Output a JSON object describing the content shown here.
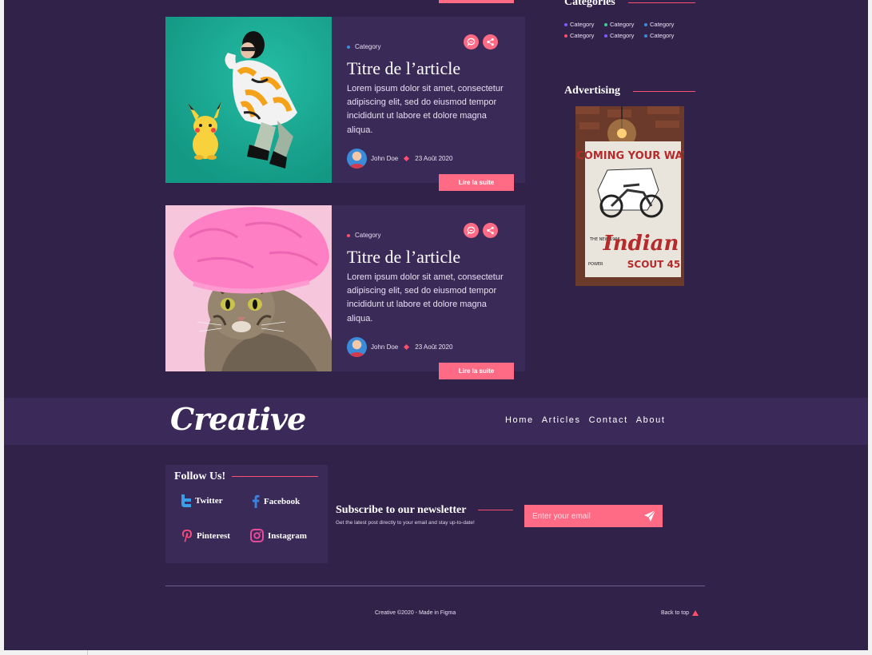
{
  "colors": {
    "background": "#31224a",
    "card": "#3a2a58",
    "accent": "#ff6b84"
  },
  "articles": [
    {
      "category": "Category",
      "category_color": "#3b8bd8",
      "title": "Titre de l’article",
      "excerpt": "Lorem ipsum dolor sit amet, consectetur adipiscing elit, sed do eiusmod tempor incididunt ut labore et dolore magna aliqua.",
      "author": "John Doe",
      "date": "23 Août 2020",
      "read_more": "Lire la suite",
      "icons": [
        "comment-icon",
        "share-icon"
      ]
    },
    {
      "category": "Category",
      "category_color": "#ff4d6d",
      "title": "Titre de l’article",
      "excerpt": "Lorem ipsum dolor sit amet, consectetur adipiscing elit, sed do eiusmod tempor incididunt ut labore et dolore magna aliqua.",
      "author": "John Doe",
      "date": "23 Août 2020",
      "read_more": "Lire la suite",
      "icons": [
        "comment-icon",
        "share-icon"
      ]
    }
  ],
  "sidebar": {
    "categories_title": "Categories",
    "categories": [
      {
        "label": "Category",
        "color": "#7a5cff"
      },
      {
        "label": "Category",
        "color": "#3ccf91"
      },
      {
        "label": "Category",
        "color": "#3b8bd8"
      },
      {
        "label": "Category",
        "color": "#ff4d6d"
      },
      {
        "label": "Category",
        "color": "#7a5cff"
      },
      {
        "label": "Category",
        "color": "#3b8bd8"
      }
    ],
    "advertising_title": "Advertising",
    "ad": {
      "line1": "COMING YOUR WAY",
      "line2": "THE NEW 1966",
      "brand": "Indian",
      "model": "SCOUT 45",
      "tag": "POWER"
    }
  },
  "navbar": {
    "logo": "Creative",
    "links": [
      "Home",
      "Articles",
      "Contact",
      "About"
    ]
  },
  "follow": {
    "title": "Follow Us!",
    "networks": [
      "Twitter",
      "Facebook",
      "Pinterest",
      "Instagram"
    ]
  },
  "newsletter": {
    "title": "Subscribe to our newsletter",
    "subtitle": "Get the latest post directly to your email and stay up-to-date!",
    "placeholder": "Enter your email"
  },
  "footer": {
    "copyright": "Creative ©2020 - Made in Figma",
    "back_to_top": "Back to top"
  }
}
